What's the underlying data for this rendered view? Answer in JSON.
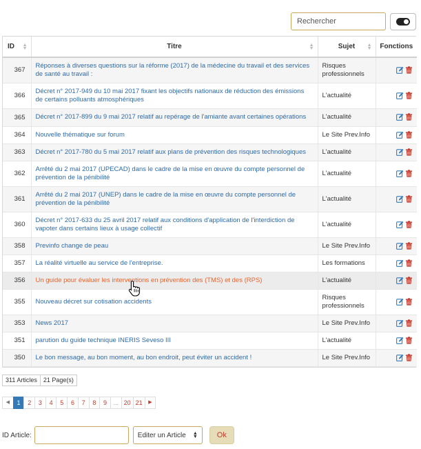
{
  "search": {
    "placeholder": "Rechercher"
  },
  "columns": {
    "id": "ID",
    "title": "Titre",
    "subject": "Sujet",
    "functions": "Fonctions"
  },
  "rows": [
    {
      "id": "367",
      "title": "Réponses à diverses questions sur la réforme (2017) de la médecine du travail et des services de santé au travail :",
      "subject": "Risques professionnels"
    },
    {
      "id": "366",
      "title": "Décret n° 2017-949 du 10 mai 2017 fixant les objectifs nationaux de réduction des émissions de certains polluants atmosphériques",
      "subject": "L'actualité"
    },
    {
      "id": "365",
      "title": "Décret n° 2017-899 du 9 mai 2017 relatif au repérage de l'amiante avant certaines opérations",
      "subject": "L'actualité"
    },
    {
      "id": "364",
      "title": "Nouvelle thématique sur forum",
      "subject": "Le Site Prev.Info"
    },
    {
      "id": "363",
      "title": "Décret n° 2017-780 du 5 mai 2017 relatif aux plans de prévention des risques technologiques",
      "subject": "L'actualité"
    },
    {
      "id": "362",
      "title": "Arrêté du 2 mai 2017 (UPECAD) dans le cadre de la mise en œuvre du compte personnel de prévention de la pénibilité",
      "subject": "L'actualité"
    },
    {
      "id": "361",
      "title": "Arrêté du 2 mai 2017 (UNEP) dans le cadre de la mise en œuvre du compte personnel de prévention de la pénibilité",
      "subject": "L'actualité"
    },
    {
      "id": "360",
      "title": "Décret n° 2017-633 du 25 avril 2017 relatif aux conditions d'application de l'interdiction de vapoter dans certains lieux à usage collectif",
      "subject": "L'actualité"
    },
    {
      "id": "358",
      "title": "Previnfo change de peau",
      "subject": "Le Site Prev.Info"
    },
    {
      "id": "357",
      "title": "La réalité virtuelle au service de l'entreprise.",
      "subject": "Les formations"
    },
    {
      "id": "356",
      "title": "Un guide pour évaluer les interventions en prévention des (TMS) et des (RPS)",
      "subject": "L'actualité"
    },
    {
      "id": "355",
      "title": "Nouveau décret sur cotisation accidents",
      "subject": "Risques professionnels"
    },
    {
      "id": "353",
      "title": "News 2017",
      "subject": "Le Site Prev.Info"
    },
    {
      "id": "351",
      "title": "parution du guide technique INERIS Seveso III",
      "subject": "L'actualité"
    },
    {
      "id": "350",
      "title": "Le bon message, au bon moment, au bon endroit, peut éviter un accident !",
      "subject": "Le Site Prev.Info"
    }
  ],
  "counts": {
    "articles": "311 Articles",
    "pages": "21 Page(s)"
  },
  "pagination": {
    "prev": "◀",
    "next": "▶",
    "pages": [
      "1",
      "2",
      "3",
      "4",
      "5",
      "6",
      "7",
      "8",
      "9",
      "...",
      "20",
      "21"
    ],
    "current": "1"
  },
  "bottom": {
    "id_label": "ID Article:",
    "select_value": "Editer un Article",
    "ok_label": "Ok"
  },
  "colors": {
    "link": "#2e6aa8",
    "link_hover": "#e8632a",
    "edit_icon": "#337ab7",
    "delete_icon": "#c0392b",
    "active_page": "#337ab7"
  }
}
